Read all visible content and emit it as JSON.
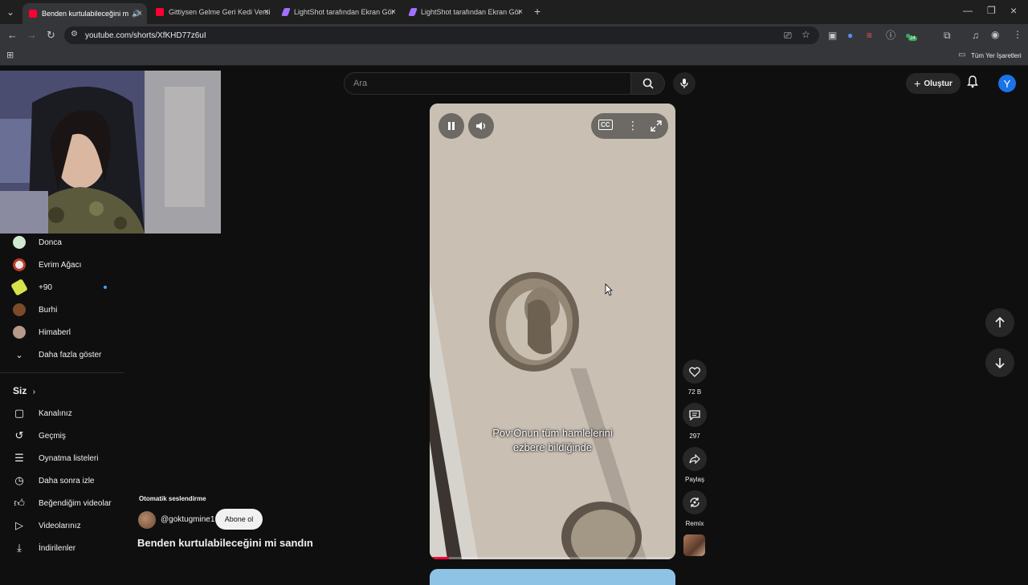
{
  "browser": {
    "tabs": [
      {
        "title": "Benden kurtulabileceğini m",
        "active": true,
        "favicon_color": "#ff0033"
      },
      {
        "title": "Gittiysen Gelme Geri Kedi Versi",
        "active": false,
        "favicon_color": "#ff0033"
      },
      {
        "title": "LightShot tarafından Ekran Gör",
        "active": false,
        "favicon_color": "#a070ff"
      },
      {
        "title": "LightShot tarafından Ekran Gör",
        "active": false,
        "favicon_color": "#a070ff"
      }
    ],
    "url": "youtube.com/shorts/XfKHD77z6uI",
    "all_bookmarks": "Tüm Yer İşaretleri",
    "extension_badge": "24"
  },
  "youtube": {
    "search_placeholder": "Ara",
    "create_label": "Oluştur",
    "avatar_letter": "Y",
    "accent": "#ff0033"
  },
  "sidebar": {
    "subscriptions": [
      {
        "name": "Donca",
        "avatar_color": "#cfe8cf"
      },
      {
        "name": "Evrim Ağacı",
        "avatar_color": "#e8e8e8"
      },
      {
        "name": "+90",
        "avatar_color": "#d8e04a",
        "new_dot": true
      },
      {
        "name": "Burhi",
        "avatar_color": "#7a4a2a"
      },
      {
        "name": "Himaberl",
        "avatar_color": "#b89a8a"
      }
    ],
    "show_more": "Daha fazla göster",
    "you_heading": "Siz",
    "you_items": [
      {
        "label": "Kanalınız",
        "icon": "channel-icon"
      },
      {
        "label": "Geçmiş",
        "icon": "history-icon"
      },
      {
        "label": "Oynatma listeleri",
        "icon": "playlists-icon"
      },
      {
        "label": "Daha sonra izle",
        "icon": "watch-later-icon"
      },
      {
        "label": "Beğendiğim videolar",
        "icon": "liked-icon"
      },
      {
        "label": "Videolarınız",
        "icon": "your-videos-icon"
      },
      {
        "label": "İndirilenler",
        "icon": "downloads-icon"
      }
    ]
  },
  "short": {
    "caption_line1": "Pov:Onun tüm hamlelerini",
    "caption_line2": "ezbere bildiğinde",
    "progress": 0.08,
    "auto_dub": "Otomatik seslendirme",
    "channel": "@goktugmine1",
    "subscribe": "Abone ol",
    "title": "Benden kurtulabileceğini mi sandın",
    "likes": "72 B",
    "comments": "297",
    "share": "Paylaş",
    "remix": "Remix"
  }
}
